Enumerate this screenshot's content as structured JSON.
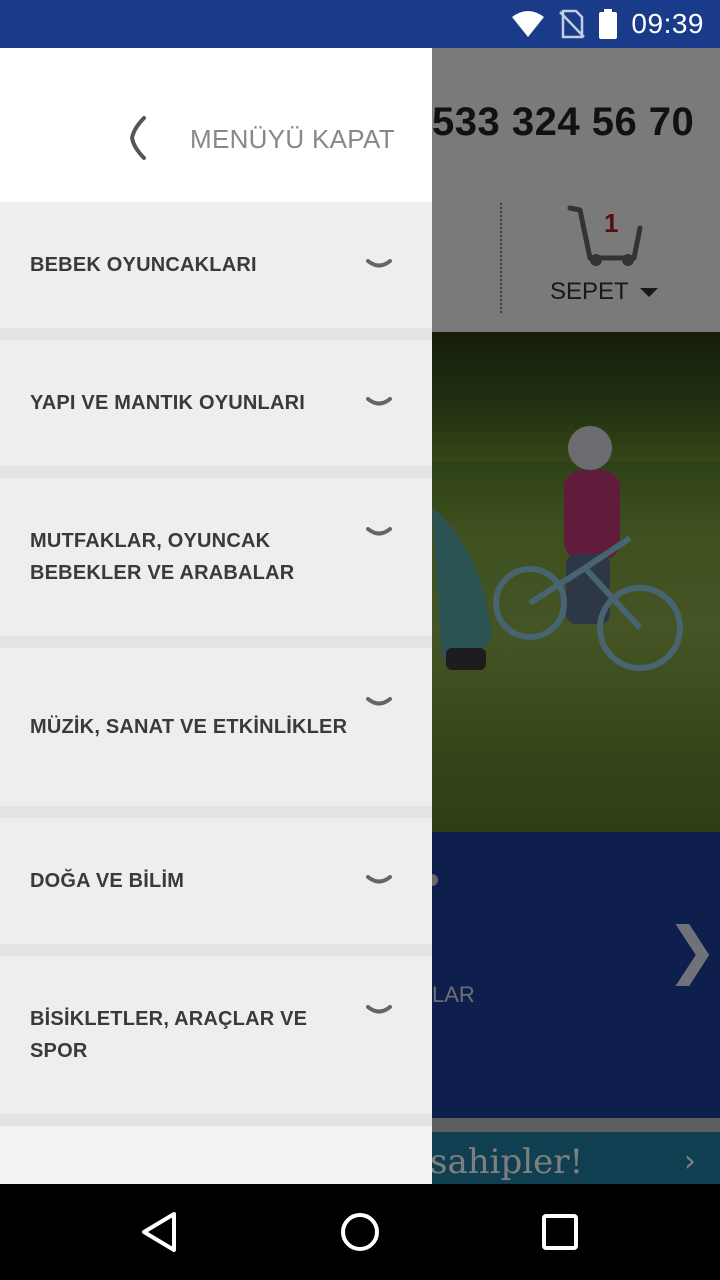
{
  "status_bar": {
    "time": "09:39",
    "icons": [
      "wifi-icon",
      "no-sim-icon",
      "battery-icon"
    ]
  },
  "background_page": {
    "phone": "533 324 56 70",
    "cart_count": "1",
    "cart_label": "SEPET",
    "banner_text": "LAR",
    "banner_next": "❯",
    "strip_text": "sahipler!",
    "strip_next": "›"
  },
  "drawer": {
    "close_label": "MENÜYÜ KAPAT",
    "items": [
      {
        "label": "BEBEK OYUNCAKLARI"
      },
      {
        "label": "YAPI VE MANTIK OYUNLARI"
      },
      {
        "label": "MUTFAKLAR, OYUNCAK BEBEKLER VE ARABALAR"
      },
      {
        "label": "MÜZİK, SANAT VE ETKİNLİKLER"
      },
      {
        "label": "DOĞA VE BİLİM"
      },
      {
        "label": "BİSİKLETLER, ARAÇLAR VE SPOR"
      }
    ]
  },
  "colors": {
    "status_bar": "#1a3a8a",
    "drawer_bg": "#eeeeee",
    "cart_count": "#b01c2a",
    "banner": "#1d3f9a"
  }
}
